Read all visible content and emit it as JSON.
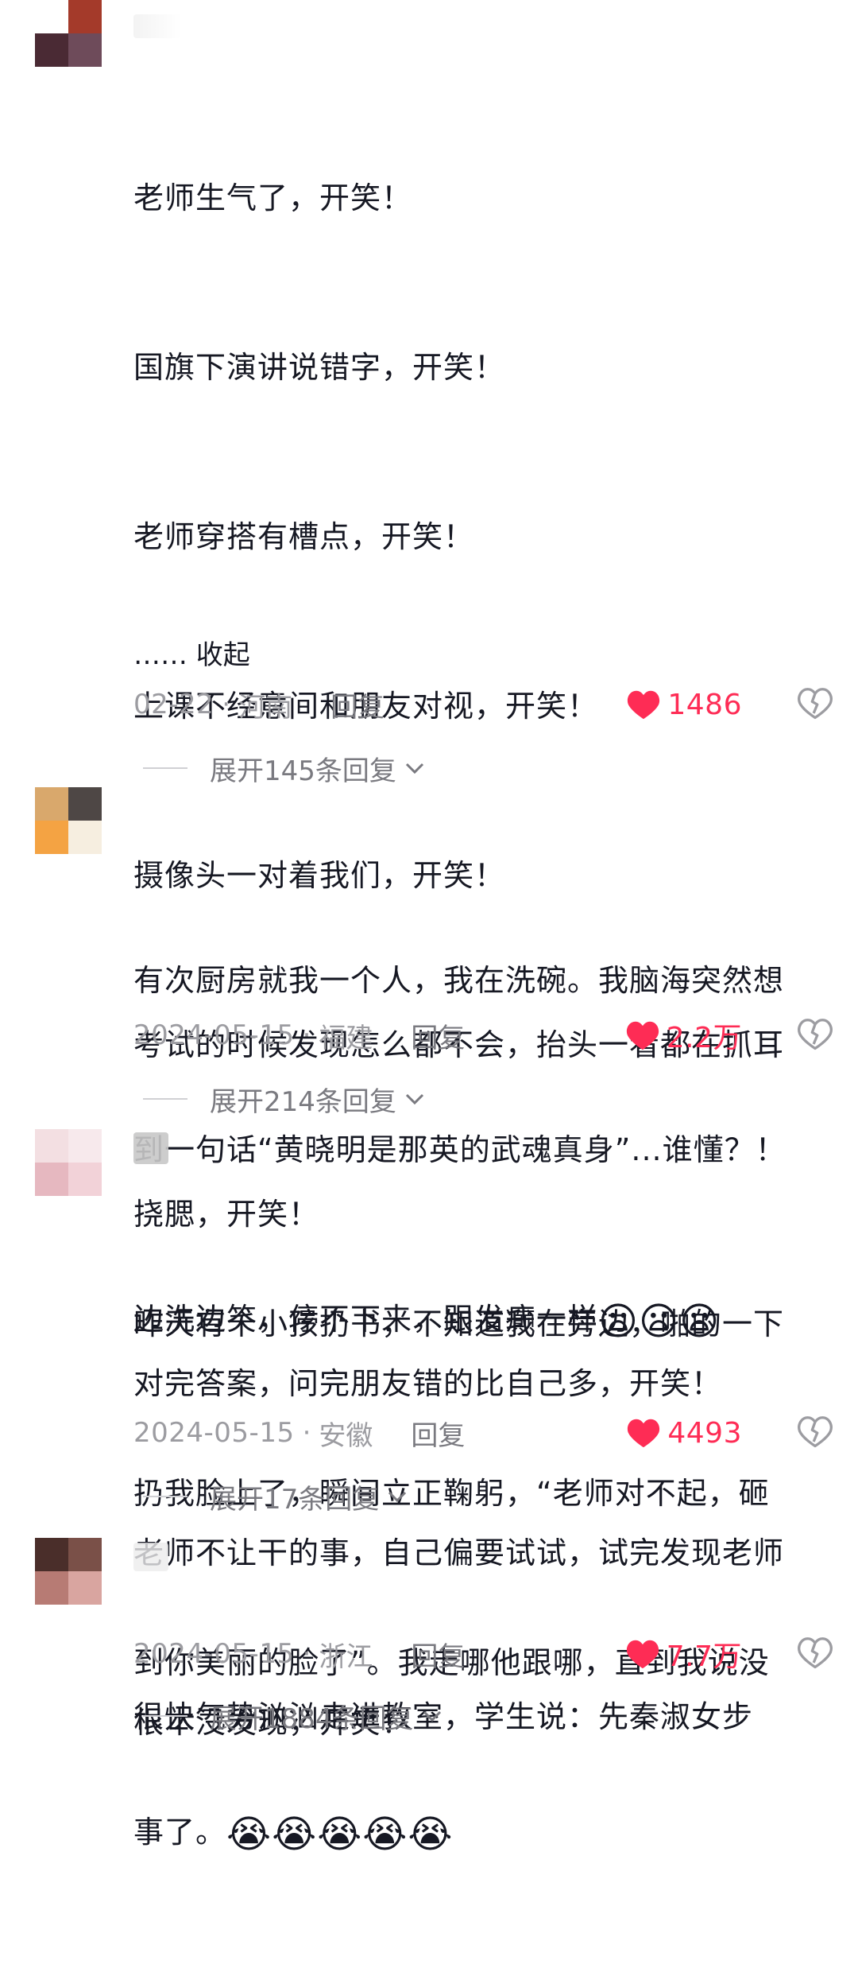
{
  "comments": [
    {
      "lines": [
        "老师生气了，开笑！",
        "国旗下演讲说错字，开笑！",
        "老师穿搭有槽点，开笑！",
        "上课不经意间和朋友对视，开笑！",
        "摄像头一对着我们，开笑！",
        "考试的时候发现怎么都不会，抬头一看都在抓耳",
        "挠腮，开笑！",
        "对完答案，问完朋友错的比自己多，开笑！",
        "老师不让干的事，自己偏要试试，试完发现老师",
        "根本没发现，开笑！"
      ],
      "collapse_label": "…… 收起",
      "date": "02-22",
      "location": "河南",
      "reply_label": "回复",
      "likes": "1486",
      "expand_label": "展开145条回复"
    },
    {
      "lines": [
        "有次厨房就我一个人，我在洗碗。我脑海突然想",
        "到一句话“黄晓明是那英的武魂真身”...谁懂？！",
        "边洗边笑，停不下来，跟发癫一样"
      ],
      "emoji": "😦😦😦",
      "date": "2024-05-15",
      "location": "福建",
      "reply_label": "回复",
      "likes": "2.2万",
      "expand_label": "展开214条回复"
    },
    {
      "lines": [
        "昨天有个小孩扔书，不知道我在旁边，啪的一下",
        "扔我脸上了，瞬间立正鞠躬，“老师对不起，砸",
        "到你美丽的脸了”。我走哪他跟哪，直到我说没",
        "事了。"
      ],
      "emoji": "😭😭😭😭😭",
      "date": "2024-05-15",
      "location": "安徽",
      "reply_label": "回复",
      "likes": "4493",
      "expand_label": "展开17条回复"
    },
    {
      "lines": [
        "很快气势汹汹走进教室，学生说：先秦淑女步"
      ],
      "date": "2024-05-15",
      "location": "浙江",
      "reply_label": "回复",
      "likes": "7.7万",
      "expand_label": "展开1884条回复"
    }
  ],
  "colors": {
    "like_red": "#fe2c55",
    "meta_gray": "#9c9ca1",
    "text": "#161823"
  },
  "icons": {
    "like": "heart-icon",
    "dislike": "broken-heart-icon",
    "expand": "chevron-down-icon"
  }
}
